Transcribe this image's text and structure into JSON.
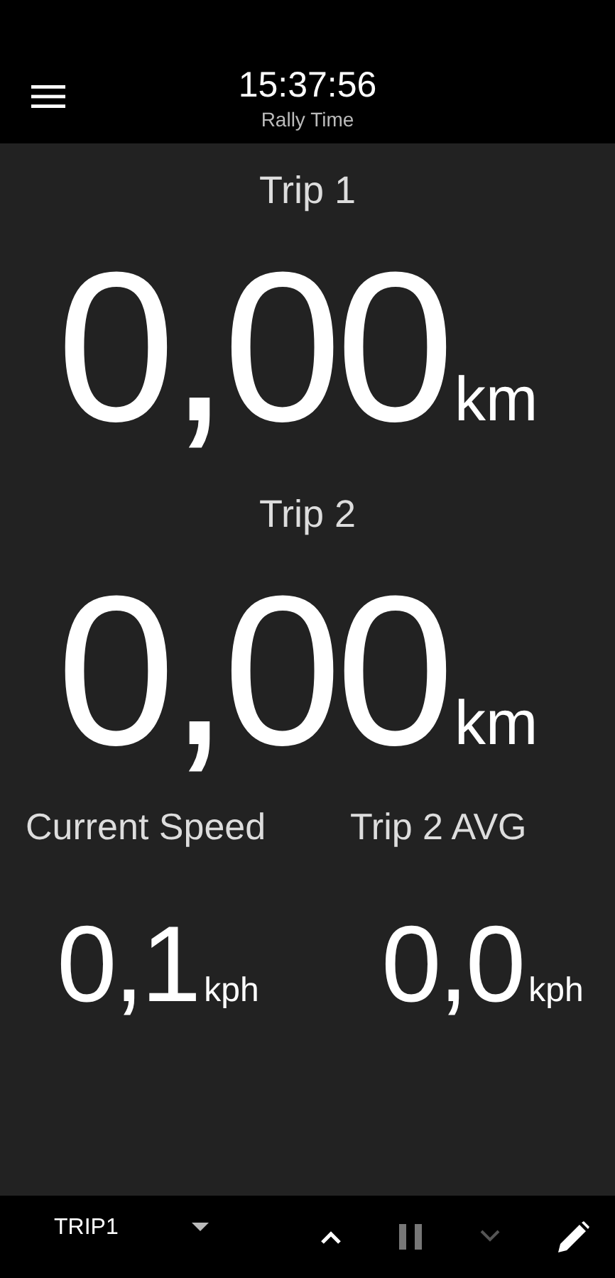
{
  "header": {
    "time": "15:37:56",
    "subtitle": "Rally Time"
  },
  "trips": [
    {
      "label": "Trip 1",
      "value": "0,00",
      "unit": "km"
    },
    {
      "label": "Trip 2",
      "value": "0,00",
      "unit": "km"
    }
  ],
  "stats": [
    {
      "label": "Current Speed",
      "value": "0,1",
      "unit": "kph"
    },
    {
      "label": "Trip 2 AVG",
      "value": "0,0",
      "unit": "kph"
    }
  ],
  "bottom_bar": {
    "trip_selector": "TRIP1",
    "buttons": [
      {
        "kind": "up",
        "disabled": false
      },
      {
        "kind": "pause",
        "disabled": true
      },
      {
        "kind": "down",
        "disabled": true
      },
      {
        "kind": "edit",
        "disabled": false
      }
    ]
  }
}
